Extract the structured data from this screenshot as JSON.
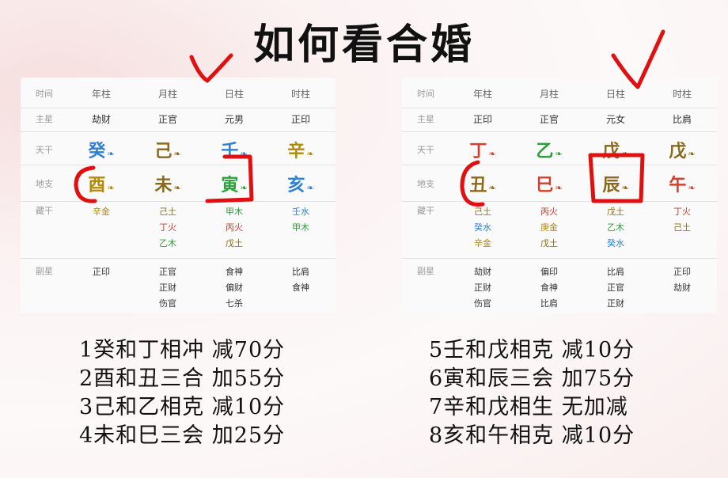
{
  "title": "如何看合婚",
  "labels": {
    "time": "时间",
    "main": "主星",
    "gan": "天干",
    "zhi": "地支",
    "cang": "藏干",
    "fu": "副星"
  },
  "left": {
    "cols": [
      "年柱",
      "月柱",
      "日柱",
      "时柱"
    ],
    "main": [
      "劫财",
      "正官",
      "元男",
      "正印"
    ],
    "gan": [
      "癸",
      "己",
      "壬",
      "辛"
    ],
    "gan_colors": [
      "#2e7fd6",
      "#8a6a1a",
      "#2e7fd6",
      "#b38a00"
    ],
    "zhi": [
      "酉",
      "未",
      "寅",
      "亥"
    ],
    "zhi_colors": [
      "#b38a00",
      "#8a6a1a",
      "#2e9e3a",
      "#2e7fd6"
    ],
    "cang": [
      [
        {
          "t": "辛金",
          "c": "#b38a00"
        }
      ],
      [
        {
          "t": "己土",
          "c": "#8a6a1a"
        },
        {
          "t": "丁火",
          "c": "#d04030"
        },
        {
          "t": "乙木",
          "c": "#2e9e3a"
        }
      ],
      [
        {
          "t": "甲木",
          "c": "#2e9e3a"
        },
        {
          "t": "丙火",
          "c": "#d04030"
        },
        {
          "t": "戊土",
          "c": "#8a6a1a"
        }
      ],
      [
        {
          "t": "壬水",
          "c": "#2e7fd6"
        },
        {
          "t": "甲木",
          "c": "#2e9e3a"
        }
      ]
    ],
    "fu": [
      [
        "正印"
      ],
      [
        "正官",
        "正财",
        "伤官"
      ],
      [
        "食神",
        "偏财",
        "七杀"
      ],
      [
        "比肩",
        "食神"
      ]
    ]
  },
  "right": {
    "cols": [
      "年柱",
      "月柱",
      "日柱",
      "时柱"
    ],
    "main": [
      "正印",
      "正官",
      "元女",
      "比肩"
    ],
    "gan": [
      "丁",
      "乙",
      "戊",
      "戊"
    ],
    "gan_colors": [
      "#d04030",
      "#2e9e3a",
      "#8a6a1a",
      "#8a6a1a"
    ],
    "zhi": [
      "丑",
      "巳",
      "辰",
      "午"
    ],
    "zhi_colors": [
      "#8a6a1a",
      "#d04030",
      "#8a6a1a",
      "#d04030"
    ],
    "cang": [
      [
        {
          "t": "己土",
          "c": "#8a6a1a"
        },
        {
          "t": "癸水",
          "c": "#2e7fd6"
        },
        {
          "t": "辛金",
          "c": "#b38a00"
        }
      ],
      [
        {
          "t": "丙火",
          "c": "#d04030"
        },
        {
          "t": "庚金",
          "c": "#b38a00"
        },
        {
          "t": "戊土",
          "c": "#8a6a1a"
        }
      ],
      [
        {
          "t": "戊土",
          "c": "#8a6a1a"
        },
        {
          "t": "乙木",
          "c": "#2e9e3a"
        },
        {
          "t": "癸水",
          "c": "#2e7fd6"
        }
      ],
      [
        {
          "t": "丁火",
          "c": "#d04030"
        },
        {
          "t": "己土",
          "c": "#8a6a1a"
        }
      ]
    ],
    "fu": [
      [
        "劫财",
        "正财",
        "伤官"
      ],
      [
        "偏印",
        "食神",
        "比肩"
      ],
      [
        "比肩",
        "正官",
        "正财"
      ],
      [
        "正印",
        "劫财"
      ]
    ]
  },
  "rules_left": [
    "1癸和丁相冲 减70分",
    "2酉和丑三合 加55分",
    "3己和乙相克 减10分",
    "4未和巳三会 加25分"
  ],
  "rules_right": [
    "5壬和戊相克 减10分",
    "6寅和辰三会 加75分",
    "7辛和戊相生 无加减",
    "8亥和午相克 减10分"
  ],
  "ink_color": "#e01010"
}
